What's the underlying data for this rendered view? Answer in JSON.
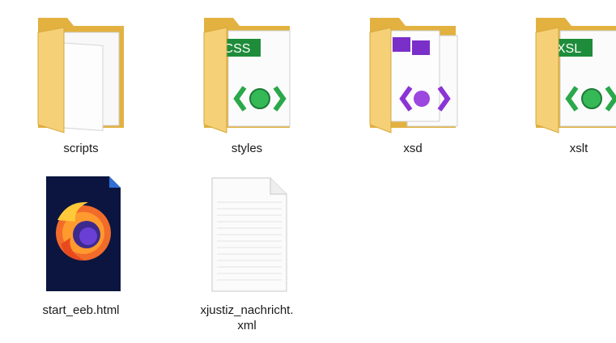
{
  "items": [
    {
      "name": "scripts",
      "type": "folder",
      "icon": "folder-icon"
    },
    {
      "name": "styles",
      "type": "folder",
      "icon": "folder-css-icon",
      "badge": "CSS",
      "badge_color": "#1e8c3a"
    },
    {
      "name": "xsd",
      "type": "folder",
      "icon": "folder-xsd-icon",
      "badge_color": "#7a2fc9"
    },
    {
      "name": "xslt",
      "type": "folder",
      "icon": "folder-xsl-icon",
      "badge": "XSL",
      "badge_color": "#1e8c3a"
    },
    {
      "name": "start_eeb.html",
      "type": "file",
      "icon": "firefox-html-icon"
    },
    {
      "name": "xjustiz_nachricht.\nxml",
      "type": "file",
      "icon": "xml-document-icon"
    }
  ],
  "colors": {
    "folder_back": "#e8b94a",
    "folder_front": "#f7d27a",
    "green_badge": "#1e8c3a",
    "purple_badge": "#7a2fc9",
    "firefox_bg": "#0b1540"
  }
}
